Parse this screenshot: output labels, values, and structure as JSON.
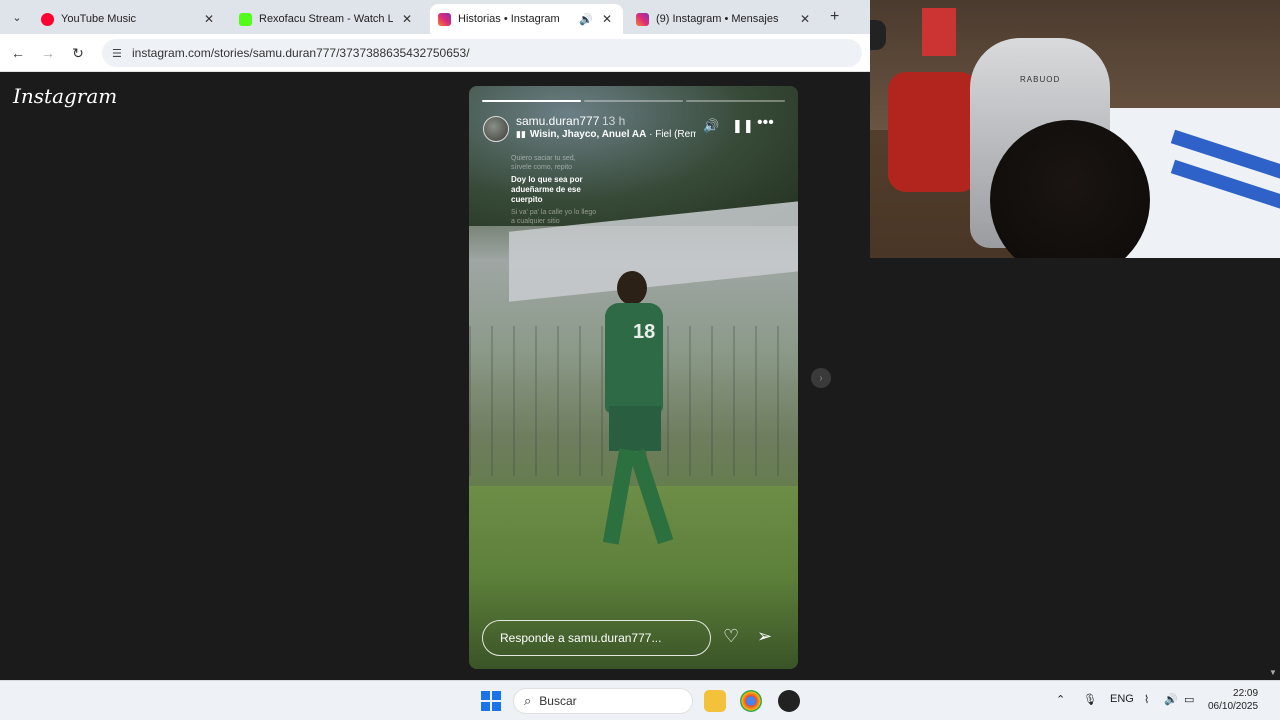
{
  "browser": {
    "tabs": [
      {
        "title": "YouTube Music",
        "color": "#ff0033",
        "active": false
      },
      {
        "title": "Rexofacu Stream - Watch Live o",
        "color": "#53fc18",
        "active": false
      },
      {
        "title": "Historias • Instagram",
        "color": "#e1306c",
        "active": true
      },
      {
        "title": "(9) Instagram • Mensajes",
        "color": "#e1306c",
        "active": false
      }
    ],
    "url": "instagram.com/stories/samu.duran777/3737388635432750653/"
  },
  "instagram": {
    "logo": "Instagram",
    "story": {
      "username": "samu.duran777",
      "time": "13 h",
      "song_artists": "Wisin, Jhayco, Anuel AA",
      "song_title": " · Fiel (Remi",
      "lyrics": {
        "line1": "Quiero saciar tu sed,",
        "line2": "sírvele como, repito",
        "line3": "Doy lo que sea por adueñarme de ese cuerpito",
        "line4": "Si va' pa' la calle yo lo llego a cualquier sitio"
      },
      "jersey_number": "18",
      "reply_placeholder": "Responde a samu.duran777...",
      "progress_segments": 3,
      "progress_current": 1
    },
    "icons": {
      "sound": "volume-icon",
      "pause": "pause-icon",
      "more": "more-icon",
      "like": "heart-icon",
      "share": "send-icon",
      "next": "chevron-right-icon"
    }
  },
  "webcam": {
    "chair_brand": "RABUOD"
  },
  "taskbar": {
    "search_label": "Buscar",
    "language": "ENG",
    "time": "22:09",
    "date": "06/10/2025"
  }
}
